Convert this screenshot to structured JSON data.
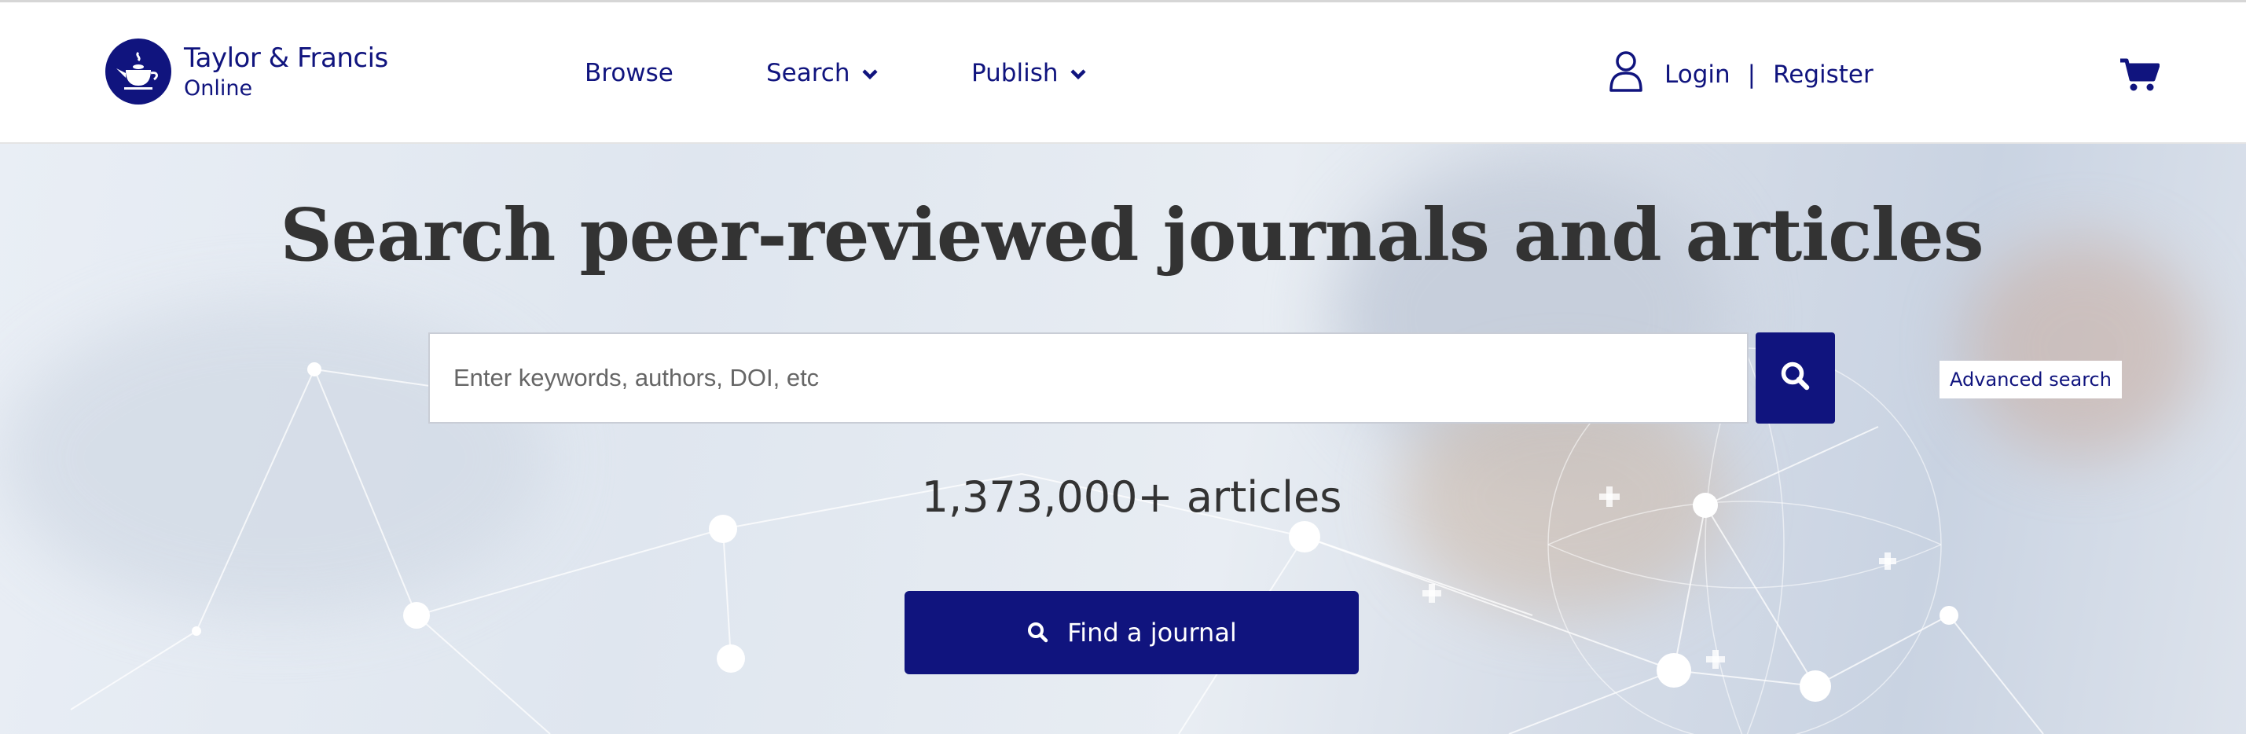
{
  "header": {
    "logo": {
      "name": "Taylor & Francis",
      "sub": "Online"
    },
    "nav": [
      {
        "label": "Browse"
      },
      {
        "label": "Search"
      },
      {
        "label": "Publish"
      }
    ],
    "account": {
      "login": "Login",
      "separator": "|",
      "register": "Register"
    },
    "icons": {
      "user": "user-icon",
      "cart": "cart-icon",
      "chevron": "chevron-down-icon",
      "logo": "teapot-logo-icon"
    }
  },
  "hero": {
    "title": "Search peer-reviewed journals and articles",
    "search": {
      "placeholder": "Enter keywords, authors, DOI, etc",
      "value": ""
    },
    "advanced_search": "Advanced search",
    "article_count": "1,373,000+ articles",
    "find_journal": "Find a journal"
  },
  "colors": {
    "brand": "#10147e",
    "text": "#333333",
    "background": "#ffffff"
  }
}
